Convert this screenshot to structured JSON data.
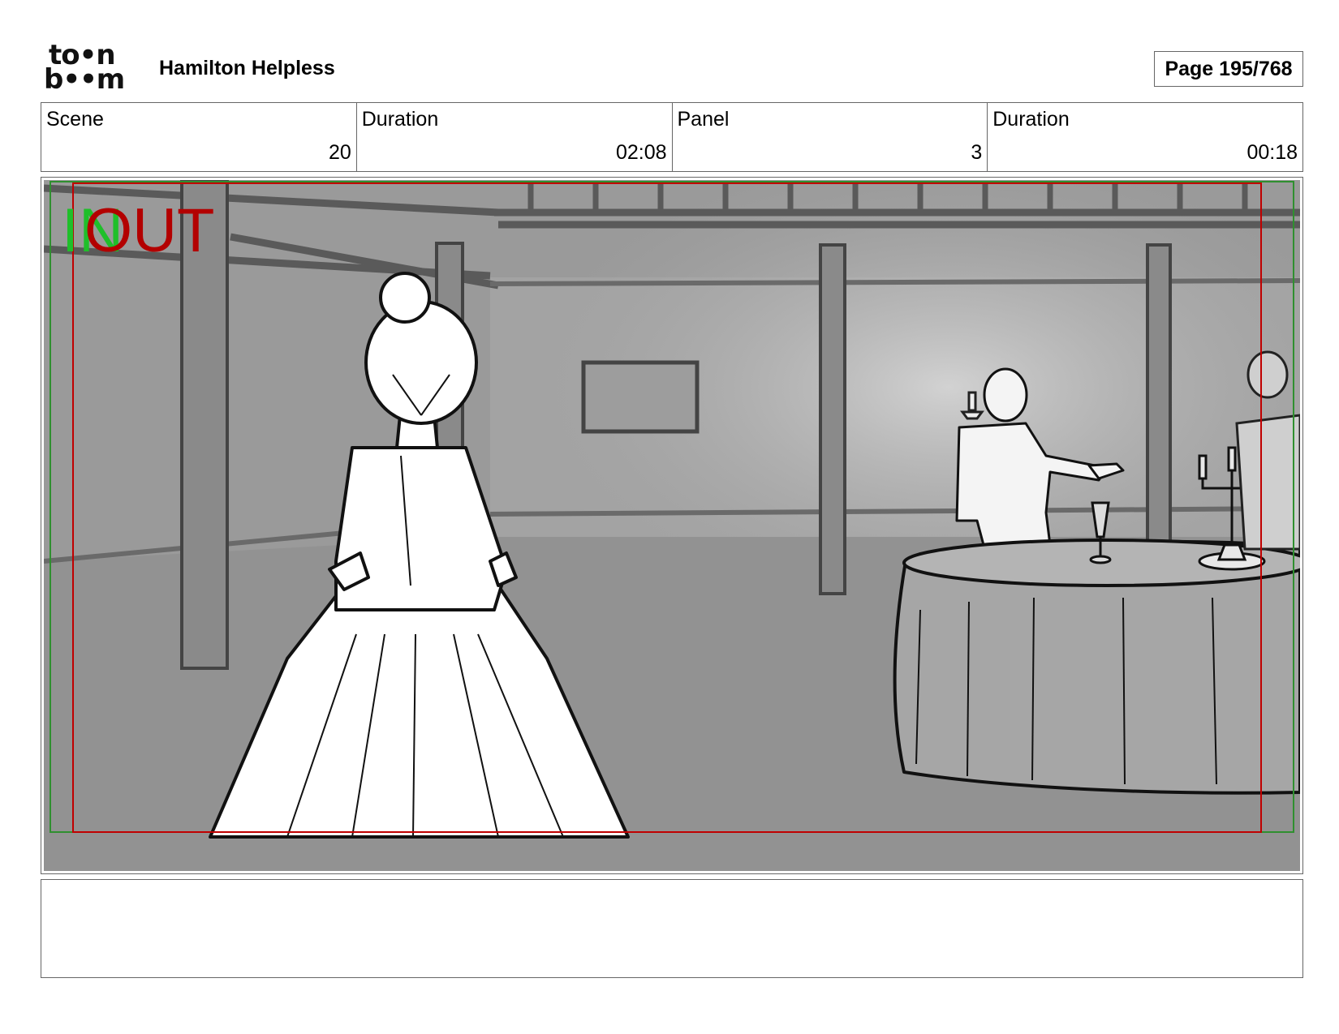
{
  "header": {
    "logo_line1": "to•n",
    "logo_line2": "b••m",
    "project_title": "Hamilton Helpless",
    "page_label": "Page",
    "page_number": "195/768"
  },
  "info": {
    "scene_label": "Scene",
    "scene_value": "20",
    "scene_duration_label": "Duration",
    "scene_duration_value": "02:08",
    "panel_label": "Panel",
    "panel_value": "3",
    "panel_duration_label": "Duration",
    "panel_duration_value": "00:18"
  },
  "panel": {
    "in_label": "IN",
    "out_label": "OUT",
    "in_color": "#1fbf2a",
    "out_color": "#b30000"
  },
  "notes": {
    "text": ""
  }
}
